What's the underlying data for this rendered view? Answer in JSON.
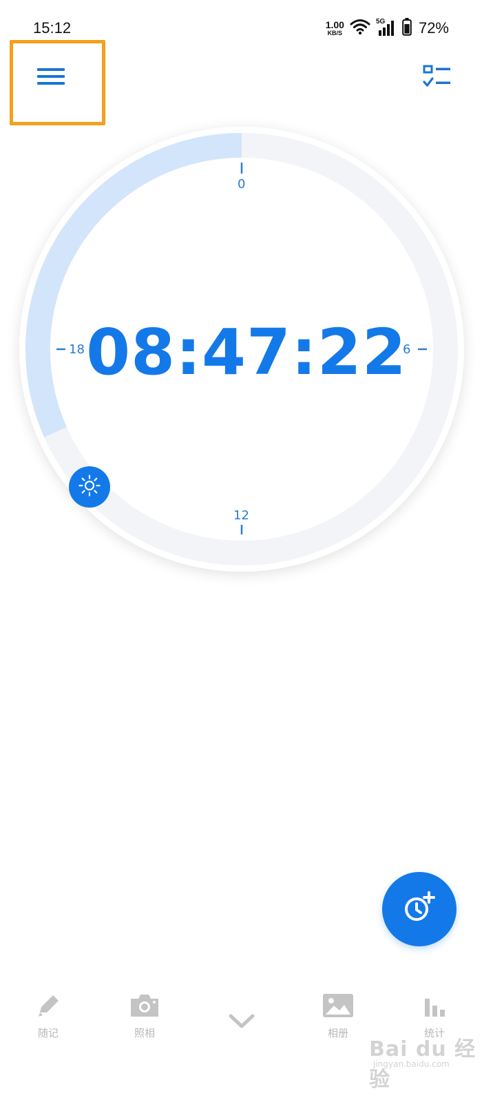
{
  "status_bar": {
    "time": "15:12",
    "net_speed_value": "1.00",
    "net_speed_unit": "KB/S",
    "network_type": "5G",
    "battery_percent": "72%",
    "icons": [
      "wifi-icon",
      "signal-icon",
      "battery-icon"
    ]
  },
  "header": {
    "menu_icon": "hamburger-menu-icon",
    "right_icon": "checklist-icon",
    "highlight_color": "#f5a01e"
  },
  "dial": {
    "elapsed_time": "08:47:22",
    "hour_labels": {
      "top": "0",
      "right": "6",
      "bottom": "12",
      "left": "18"
    },
    "progress_from_hour": 0,
    "progress_to_hour": 16.4,
    "progress_direction": "counter-clockwise",
    "knob_icon": "sun-icon",
    "accent_color": "#1479e8",
    "progress_color": "#d3e5fb",
    "track_color": "#f2f4f8"
  },
  "fab": {
    "icon": "clock-plus-icon"
  },
  "bottom_nav": {
    "items": [
      {
        "label": "随记",
        "icon": "pencil-icon"
      },
      {
        "label": "照相",
        "icon": "camera-icon"
      },
      {
        "label": "",
        "icon": "chevron-down-icon"
      },
      {
        "label": "相册",
        "icon": "image-icon"
      },
      {
        "label": "统计",
        "icon": "bar-chart-icon"
      }
    ]
  },
  "watermark": {
    "brand": "Bai du 经验",
    "url": "jingyan.baidu.com"
  }
}
